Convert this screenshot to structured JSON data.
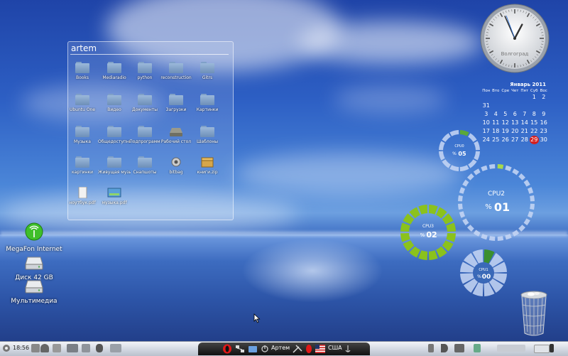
{
  "folder_view": {
    "title": "artem",
    "items": [
      {
        "label": "Books",
        "type": "folder"
      },
      {
        "label": "Mediaradio",
        "type": "folder"
      },
      {
        "label": "python",
        "type": "folder"
      },
      {
        "label": "reconstruction",
        "type": "folder"
      },
      {
        "label": "Gitrs",
        "type": "folder"
      },
      {
        "label": "Ubuntu One",
        "type": "folder"
      },
      {
        "label": "Видео",
        "type": "folder"
      },
      {
        "label": "Документы",
        "type": "folder"
      },
      {
        "label": "Загрузки",
        "type": "folder"
      },
      {
        "label": "Картинки",
        "type": "folder"
      },
      {
        "label": "Музыка",
        "type": "folder"
      },
      {
        "label": "Общедоступные",
        "type": "folder"
      },
      {
        "label": "Подпрограмм",
        "type": "folder"
      },
      {
        "label": "Рабочий стол",
        "type": "drive"
      },
      {
        "label": "Шаблоны",
        "type": "folder"
      },
      {
        "label": "картинки",
        "type": "folder"
      },
      {
        "label": "Живущая музыка",
        "type": "folder"
      },
      {
        "label": "Снапшоты",
        "type": "folder"
      },
      {
        "label": "bitbag",
        "type": "gear"
      },
      {
        "label": "книги.zip",
        "type": "archive"
      },
      {
        "label": "ноутбук.pdf",
        "type": "document"
      },
      {
        "label": "музыка.pdf",
        "type": "image"
      }
    ]
  },
  "desktop_icons": [
    {
      "label": "MegaFon Internet",
      "icon": "antenna-icon"
    },
    {
      "label": "Диск 42 GB",
      "icon": "hard-drive-icon"
    },
    {
      "label": "Мультимедиа",
      "icon": "hard-drive-icon"
    }
  ],
  "clock": {
    "label": "Волгоград",
    "hour": 12,
    "minute": 56
  },
  "calendar": {
    "title": "Январь 2011",
    "weekdays": [
      "Пон",
      "Вто",
      "Сре",
      "Чет",
      "Пят",
      "Суб",
      "Вос"
    ],
    "weeks": [
      [
        "",
        "",
        "",
        "",
        "",
        "1",
        "2"
      ],
      [
        "31",
        "",
        "",
        "",
        "",
        "",
        ""
      ],
      [
        "3",
        "4",
        "5",
        "6",
        "7",
        "8",
        "9"
      ],
      [
        "10",
        "11",
        "12",
        "13",
        "14",
        "15",
        "16"
      ],
      [
        "17",
        "18",
        "19",
        "20",
        "21",
        "22",
        "23"
      ],
      [
        "24",
        "25",
        "26",
        "27",
        "28",
        "29",
        "30"
      ]
    ],
    "today": "29"
  },
  "cpu_gauges": [
    {
      "name": "CPU0",
      "value": "05",
      "color": "#5aa83a"
    },
    {
      "name": "CPU2",
      "value": "01",
      "color": "#a7d94a"
    },
    {
      "name": "CPU3",
      "value": "02",
      "color": "#8bc21c"
    },
    {
      "name": "CPU1",
      "value": "00",
      "color": "#3b8f2e"
    }
  ],
  "taskbar": {
    "time": "18:56",
    "dock_user": "Артем",
    "dock_locale": "США"
  },
  "colors": {
    "desktop_top": "#1f44a8",
    "sea": "#2d55a8",
    "calendar_today": "#d42020"
  }
}
